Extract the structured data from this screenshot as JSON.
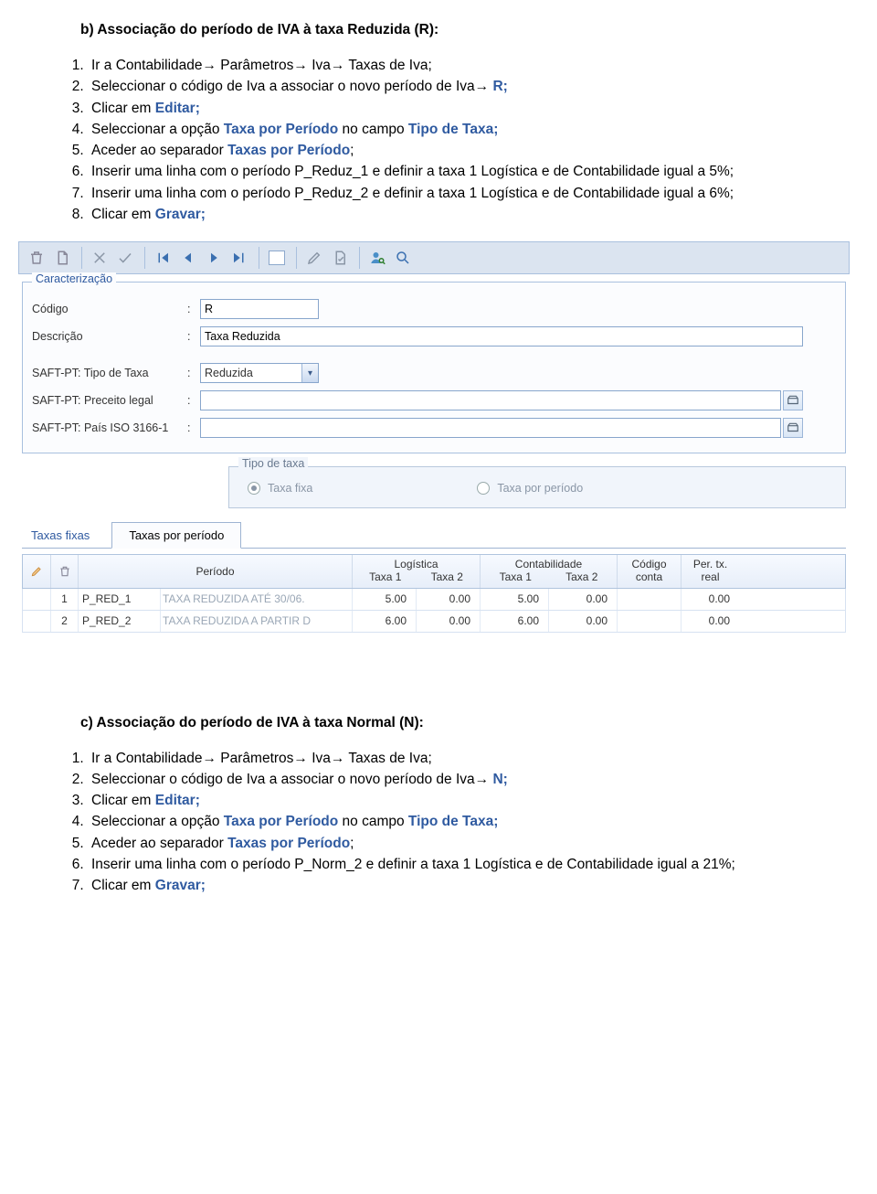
{
  "section_b": {
    "title": "b)  Associação do período de IVA à taxa Reduzida (R):",
    "items": [
      {
        "pre": "Ir a Contabilidade→ Parâmetros→ Iva→ Taxas de Iva;"
      },
      {
        "pre": "Seleccionar o código de Iva a associar o novo período de Iva→ ",
        "hl": "R;"
      },
      {
        "pre": "Clicar em ",
        "hl": "Editar;"
      },
      {
        "pre": "Seleccionar a opção ",
        "hl": "Taxa por Período",
        "post": " no campo ",
        "hl2": "Tipo de Taxa;"
      },
      {
        "pre": "Aceder ao separador ",
        "hl": "Taxas por Período",
        "post": ";"
      },
      {
        "pre": "Inserir uma linha com o período P_Reduz_1 e definir a taxa 1 Logística e de Contabilidade igual a 5%;"
      },
      {
        "pre": "Inserir uma linha com o período P_Reduz_2 e definir a taxa 1 Logística e de Contabilidade igual a 6%;"
      },
      {
        "pre": "Clicar em ",
        "hl": "Gravar;"
      }
    ]
  },
  "screenshot": {
    "fieldset_legend": "Caracterização",
    "labels": {
      "codigo": "Código",
      "descricao": "Descrição",
      "saft_tipo": "SAFT-PT: Tipo de Taxa",
      "saft_preceito": "SAFT-PT: Preceito legal",
      "saft_pais": "SAFT-PT: País ISO 3166-1"
    },
    "values": {
      "codigo": "R",
      "descricao": "Taxa Reduzida",
      "saft_tipo": "Reduzida",
      "saft_preceito": "",
      "saft_pais": ""
    },
    "tipo_taxa": {
      "legend": "Tipo de taxa",
      "option_fixa": "Taxa fixa",
      "option_periodo": "Taxa por período"
    },
    "tabs": {
      "fixas": "Taxas fixas",
      "periodo": "Taxas por período"
    },
    "table": {
      "headers": {
        "periodo": "Período",
        "logistica": "Logística",
        "contab": "Contabilidade",
        "taxa1": "Taxa 1",
        "taxa2": "Taxa 2",
        "codigo_conta": "Código conta",
        "per_tx_real": "Per. tx. real"
      },
      "rows": [
        {
          "n": "1",
          "code": "P_RED_1",
          "desc": "TAXA REDUZIDA ATÉ 30/06.",
          "l1": "5.00",
          "l2": "0.00",
          "c1": "5.00",
          "c2": "0.00",
          "cc": "",
          "pr": "0.00"
        },
        {
          "n": "2",
          "code": "P_RED_2",
          "desc": "TAXA REDUZIDA A PARTIR D",
          "l1": "6.00",
          "l2": "0.00",
          "c1": "6.00",
          "c2": "0.00",
          "cc": "",
          "pr": "0.00"
        }
      ]
    }
  },
  "section_c": {
    "title": "c)  Associação do período de IVA à taxa Normal (N):",
    "items": [
      {
        "pre": "Ir a Contabilidade→ Parâmetros→ Iva→ Taxas de Iva;"
      },
      {
        "pre": "Seleccionar o código de Iva a associar o novo período de Iva→ ",
        "hl": "N;"
      },
      {
        "pre": "Clicar em ",
        "hl": "Editar;"
      },
      {
        "pre": "Seleccionar a opção ",
        "hl": "Taxa por Período",
        "post": " no campo ",
        "hl2": "Tipo de Taxa;"
      },
      {
        "pre": "Aceder ao separador ",
        "hl": "Taxas por Período",
        "post": ";"
      },
      {
        "pre": "Inserir uma linha com o período P_Norm_2 e definir a taxa 1 Logística e de Contabilidade igual a 21%;"
      },
      {
        "pre": "Clicar em ",
        "hl": "Gravar;"
      }
    ]
  }
}
